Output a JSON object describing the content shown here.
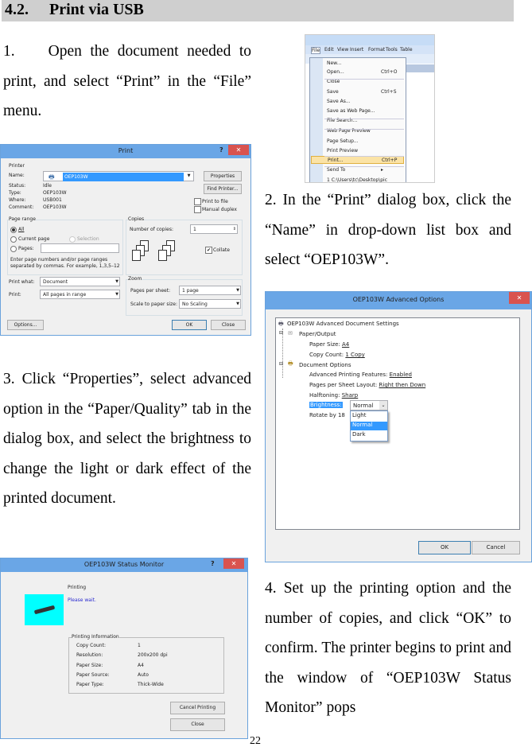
{
  "heading": {
    "number": "4.2.",
    "title": "Print via USB"
  },
  "steps": [
    "1.    Open the document needed to print, and select “Print” in the “File” menu.",
    "2. In the “Print” dialog box, click the “Name” in drop-down list box and select “OEP103W”.",
    "3. Click “Properties”, select advanced option in the “Paper/Quality” tab in the dialog box, and select the brightness to change the light or dark effect of the printed document.",
    "4. Set up the printing option and the number of copies, and click “OK” to confirm. The printer begins to print and the window of “OEP103W Status Monitor” pops"
  ],
  "page_number": "22",
  "file_menu": {
    "menubar": [
      "File",
      "Edit",
      "View",
      "Insert",
      "Format",
      "Tools",
      "Table"
    ],
    "items": [
      {
        "label": "New...",
        "shortcut": ""
      },
      {
        "label": "Open...",
        "shortcut": "Ctrl+O"
      },
      {
        "label": "Close",
        "shortcut": ""
      },
      {
        "label": "Save",
        "shortcut": "Ctrl+S"
      },
      {
        "label": "Save As...",
        "shortcut": ""
      },
      {
        "label": "Save as Web Page...",
        "shortcut": ""
      },
      {
        "label": "File Search...",
        "shortcut": ""
      },
      {
        "label": "Web Page Preview",
        "shortcut": ""
      },
      {
        "label": "Page Setup...",
        "shortcut": ""
      },
      {
        "label": "Print Preview",
        "shortcut": ""
      },
      {
        "label": "Print...",
        "shortcut": "Ctrl+P"
      },
      {
        "label": "Send To",
        "shortcut": "▸"
      },
      {
        "label": "1 C:\\Users\\tc\\Desktop\\pic",
        "shortcut": ""
      }
    ],
    "highlight_color": "#fbe3a6"
  },
  "print_dialog": {
    "title": "Print",
    "help": "?",
    "close": "✕",
    "printer_group": "Printer",
    "name_label": "Name:",
    "name_value": "OEP103W",
    "status_label": "Status:",
    "status_value": "Idle",
    "type_label": "Type:",
    "type_value": "OEP103W",
    "where_label": "Where:",
    "where_value": "USB001",
    "comment_label": "Comment:",
    "comment_value": "OEP103W",
    "properties": "Properties",
    "find_printer": "Find Printer...",
    "print_to_file": "Print to file",
    "manual_duplex": "Manual duplex",
    "page_range": "Page range",
    "all": "All",
    "current_page": "Current page",
    "selection": "Selection",
    "pages": "Pages:",
    "help_text_1": "Enter page numbers and/or page ranges",
    "help_text_2": "separated by commas.  For example, 1,3,5–12",
    "copies": "Copies",
    "num_copies_label": "Number of copies:",
    "num_copies": "1",
    "collate": "Collate",
    "print_what_label": "Print what:",
    "print_what": "Document",
    "print_label": "Print:",
    "print_value": "All pages in range",
    "zoom": "Zoom",
    "pps_label": "Pages per sheet:",
    "pps": "1 page",
    "scale_label": "Scale to paper size:",
    "scale": "No Scaling",
    "options": "Options...",
    "ok": "OK",
    "close_btn": "Close"
  },
  "advanced": {
    "title": "OEP103W Advanced Options",
    "close": "✕",
    "root": "OEP103W Advanced Document Settings",
    "paper_output": "Paper/Output",
    "paper_size_label": "Paper Size:",
    "paper_size": "A4",
    "copy_count_label": "Copy Count:",
    "copy_count": "1 Copy",
    "doc_options": "Document Options",
    "apf_label": "Advanced Printing Features:",
    "apf": "Enabled",
    "pps_label": "Pages per Sheet Layout:",
    "pps": "Right then Down",
    "halftoning_label": "Halftoning:",
    "halftoning": "Sharp",
    "brightness_label": "Brightness:",
    "brightness": "Normal",
    "rotate": "Rotate by 18",
    "options": [
      "Light",
      "Normal",
      "Dark"
    ],
    "ok": "OK",
    "cancel": "Cancel",
    "selection_color": "#3399ff"
  },
  "status_monitor": {
    "title": "OEP103W Status Monitor",
    "help": "?",
    "close": "✕",
    "status": "Printing",
    "message": "Please wait.",
    "group": "Printing Information",
    "rows": [
      {
        "label": "Copy Count:",
        "value": "1"
      },
      {
        "label": "Resolution:",
        "value": "200x200 dpi"
      },
      {
        "label": "Paper Size:",
        "value": "A4"
      },
      {
        "label": "Paper Source:",
        "value": "Auto"
      },
      {
        "label": "Paper Type:",
        "value": "Thick-Wide"
      }
    ],
    "cancel_printing": "Cancel Printing",
    "close_btn": "Close"
  }
}
